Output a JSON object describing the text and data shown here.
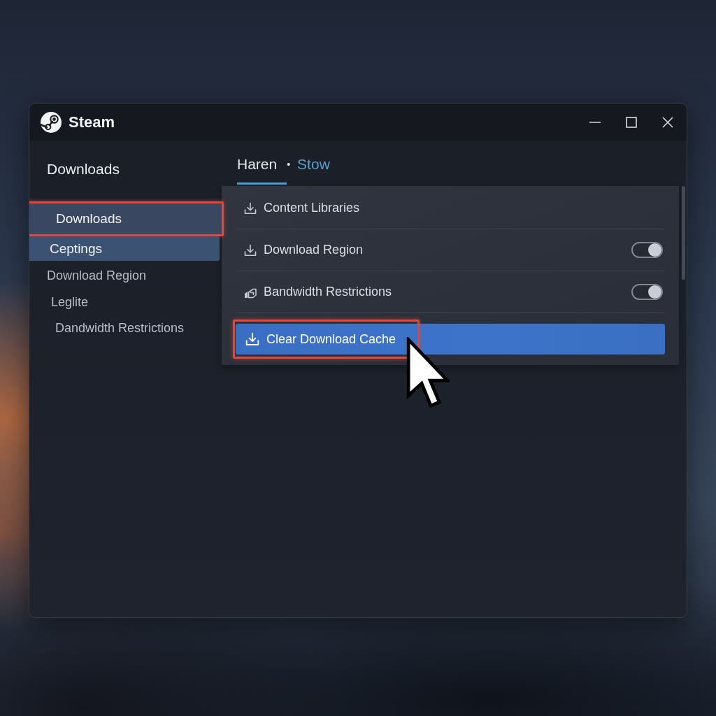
{
  "window": {
    "title": "Steam"
  },
  "sidebar": {
    "heading": "Downloads",
    "items": [
      {
        "label": "Downloads",
        "selected": false,
        "hovered": true,
        "annotated": true
      },
      {
        "label": "Ceptings",
        "selected": true,
        "hovered": false,
        "annotated": false
      },
      {
        "label": "Download Region",
        "selected": false,
        "hovered": false,
        "annotated": false
      },
      {
        "label": "Leglite",
        "selected": false,
        "hovered": false,
        "annotated": false
      },
      {
        "label": "Dandwidth Restrictions",
        "selected": false,
        "hovered": false,
        "annotated": false
      }
    ]
  },
  "tabs": {
    "items": [
      {
        "label": "Haren",
        "selected": true
      },
      {
        "label": "Stow",
        "selected": false
      }
    ],
    "separator": "•"
  },
  "settings": {
    "rows": [
      {
        "kind": "link",
        "label": "Content Libraries"
      },
      {
        "kind": "toggle",
        "label": "Download Region",
        "on": true
      },
      {
        "kind": "toggle",
        "label": "Bandwidth Restrictions",
        "on": true
      }
    ],
    "action": {
      "label": "Clear Download Cache",
      "annotated": true
    }
  }
}
